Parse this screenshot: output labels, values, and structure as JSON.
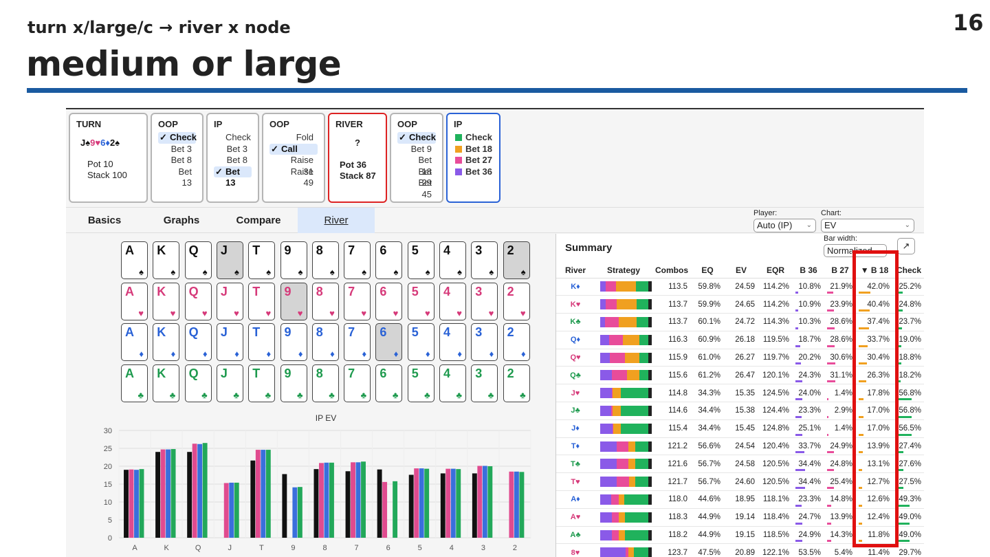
{
  "slide": {
    "number": "16",
    "subtitle": "turn x/large/c → river x node",
    "title": "medium or large"
  },
  "nodes": [
    {
      "hdr": "TURN",
      "board": [
        [
          "J",
          "♠",
          "#111"
        ],
        [
          "9",
          "♥",
          "#d63a7a"
        ],
        [
          "6",
          "♦",
          "#2a62d6"
        ],
        [
          "2",
          "♠",
          "#111"
        ]
      ],
      "pot": "Pot 10",
      "stack": "Stack 100"
    },
    {
      "hdr": "OOP",
      "items": [
        [
          "Check",
          true
        ],
        [
          "Bet 3",
          false
        ],
        [
          "Bet 8",
          false
        ],
        [
          "Bet 13",
          false
        ]
      ]
    },
    {
      "hdr": "IP",
      "items": [
        [
          "Check",
          false
        ],
        [
          "Bet 3",
          false
        ],
        [
          "Bet 8",
          false
        ],
        [
          "Bet 13",
          true
        ]
      ]
    },
    {
      "hdr": "OOP",
      "items": [
        [
          "Fold",
          false
        ],
        [
          "Call",
          true
        ],
        [
          "Raise 31",
          false
        ],
        [
          "Raise 49",
          false
        ]
      ]
    },
    {
      "hdr": "RIVER",
      "card": "?",
      "pot": "Pot 36",
      "stack": "Stack 87"
    },
    {
      "hdr": "OOP",
      "items": [
        [
          "Check",
          true
        ],
        [
          "Bet 9",
          false
        ],
        [
          "Bet 18",
          false
        ],
        [
          "Bet 29",
          false
        ],
        [
          "Bet 45",
          false
        ]
      ]
    },
    {
      "hdr": "IP",
      "actions": [
        [
          "Check",
          "#20b25c"
        ],
        [
          "Bet 18",
          "#f0a020"
        ],
        [
          "Bet 27",
          "#e84c9a"
        ],
        [
          "Bet 36",
          "#8a5ae8"
        ]
      ]
    }
  ],
  "tabs": [
    "Basics",
    "Graphs",
    "Compare",
    "River"
  ],
  "controls": {
    "player_label": "Player:",
    "player_value": "Auto (IP)",
    "chart_label": "Chart:",
    "chart_value": "EV",
    "barwidth_label": "Bar width:",
    "barwidth_value": "Normalized"
  },
  "ranks": [
    "A",
    "K",
    "Q",
    "J",
    "T",
    "9",
    "8",
    "7",
    "6",
    "5",
    "4",
    "3",
    "2"
  ],
  "suits": [
    {
      "sym": "♠",
      "color": "#111"
    },
    {
      "sym": "♥",
      "color": "#d63a7a"
    },
    {
      "sym": "♦",
      "color": "#2a62d6"
    },
    {
      "sym": "♣",
      "color": "#1e9a4e"
    }
  ],
  "dimmed_cards": [
    "J♠",
    "2♠",
    "9♥",
    "6♦"
  ],
  "summary": {
    "title": "Summary",
    "columns": [
      "River",
      "Strategy",
      "Combos",
      "EQ",
      "EV",
      "EQR",
      "B 36",
      "B 27",
      "▼ B 18",
      "Check"
    ],
    "rows": [
      [
        "K♦",
        "113.5",
        "59.8%",
        "24.59",
        "114.2%",
        "10.8%",
        "21.9%",
        "42.0%",
        "25.2%"
      ],
      [
        "K♥",
        "113.7",
        "59.9%",
        "24.65",
        "114.2%",
        "10.9%",
        "23.9%",
        "40.4%",
        "24.8%"
      ],
      [
        "K♣",
        "113.7",
        "60.1%",
        "24.72",
        "114.3%",
        "10.3%",
        "28.6%",
        "37.4%",
        "23.7%"
      ],
      [
        "Q♦",
        "116.3",
        "60.9%",
        "26.18",
        "119.5%",
        "18.7%",
        "28.6%",
        "33.7%",
        "19.0%"
      ],
      [
        "Q♥",
        "115.9",
        "61.0%",
        "26.27",
        "119.7%",
        "20.2%",
        "30.6%",
        "30.4%",
        "18.8%"
      ],
      [
        "Q♣",
        "115.6",
        "61.2%",
        "26.47",
        "120.1%",
        "24.3%",
        "31.1%",
        "26.3%",
        "18.2%"
      ],
      [
        "J♥",
        "114.8",
        "34.3%",
        "15.35",
        "124.5%",
        "24.0%",
        "1.4%",
        "17.8%",
        "56.8%"
      ],
      [
        "J♣",
        "114.6",
        "34.4%",
        "15.38",
        "124.4%",
        "23.3%",
        "2.9%",
        "17.0%",
        "56.8%"
      ],
      [
        "J♦",
        "115.4",
        "34.4%",
        "15.45",
        "124.8%",
        "25.1%",
        "1.4%",
        "17.0%",
        "56.5%"
      ],
      [
        "T♦",
        "121.2",
        "56.6%",
        "24.54",
        "120.4%",
        "33.7%",
        "24.9%",
        "13.9%",
        "27.4%"
      ],
      [
        "T♣",
        "121.6",
        "56.7%",
        "24.58",
        "120.5%",
        "34.4%",
        "24.8%",
        "13.1%",
        "27.6%"
      ],
      [
        "T♥",
        "121.7",
        "56.7%",
        "24.60",
        "120.5%",
        "34.4%",
        "25.4%",
        "12.7%",
        "27.5%"
      ],
      [
        "A♦",
        "118.0",
        "44.6%",
        "18.95",
        "118.1%",
        "23.3%",
        "14.8%",
        "12.6%",
        "49.3%"
      ],
      [
        "A♥",
        "118.3",
        "44.9%",
        "19.14",
        "118.4%",
        "24.7%",
        "13.9%",
        "12.4%",
        "49.0%"
      ],
      [
        "A♣",
        "118.2",
        "44.9%",
        "19.15",
        "118.5%",
        "24.9%",
        "14.3%",
        "11.8%",
        "49.0%"
      ],
      [
        "8♥",
        "123.7",
        "47.5%",
        "20.89",
        "122.1%",
        "53.5%",
        "5.4%",
        "11.4%",
        "29.7%"
      ]
    ]
  },
  "chart_data": {
    "type": "bar",
    "title": "IP EV",
    "categories": [
      "A",
      "K",
      "Q",
      "J",
      "T",
      "9",
      "8",
      "7",
      "6",
      "5",
      "4",
      "3",
      "2"
    ],
    "ylim": [
      0,
      30
    ],
    "yticks": [
      0,
      5,
      10,
      15,
      20,
      25,
      30
    ],
    "series": [
      {
        "color": "#111111",
        "values": [
          19,
          24,
          24,
          null,
          21.6,
          17.8,
          19.2,
          18.6,
          19.1,
          17.6,
          18,
          18,
          null
        ]
      },
      {
        "color": "#e04b8f",
        "values": [
          19.1,
          24.7,
          26.3,
          15.3,
          24.6,
          null,
          20.9,
          21.1,
          15.6,
          19.4,
          19.3,
          20.1,
          18.5
        ]
      },
      {
        "color": "#3a6fdc",
        "values": [
          19,
          24.7,
          26.2,
          15.4,
          24.6,
          14.1,
          21,
          21.1,
          null,
          19.4,
          19.3,
          20.1,
          18.5
        ]
      },
      {
        "color": "#22a85a",
        "values": [
          19.2,
          24.8,
          26.5,
          15.4,
          24.6,
          14.2,
          21,
          21.3,
          15.8,
          19.3,
          19.2,
          20,
          18.4
        ]
      }
    ],
    "grid": true
  }
}
